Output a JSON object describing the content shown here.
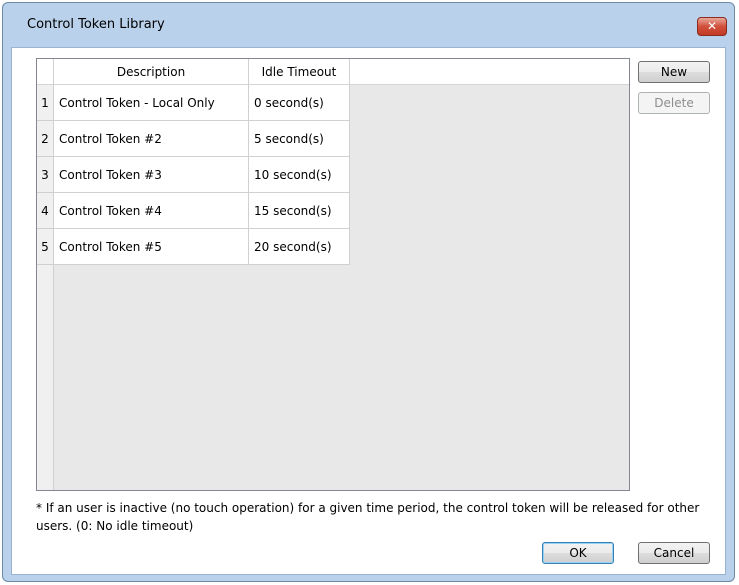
{
  "window": {
    "title": "Control Token Library",
    "close_icon": "close-icon"
  },
  "table": {
    "columns": [
      "Description",
      "Idle Timeout"
    ],
    "rows": [
      {
        "num": "1",
        "description": "Control Token - Local Only",
        "timeout": "0 second(s)"
      },
      {
        "num": "2",
        "description": "Control Token #2",
        "timeout": "5 second(s)"
      },
      {
        "num": "3",
        "description": "Control Token #3",
        "timeout": "10 second(s)"
      },
      {
        "num": "4",
        "description": "Control Token #4",
        "timeout": "15 second(s)"
      },
      {
        "num": "5",
        "description": "Control Token #5",
        "timeout": "20 second(s)"
      }
    ]
  },
  "buttons": {
    "new": "New",
    "delete": "Delete",
    "ok": "OK",
    "cancel": "Cancel"
  },
  "footnote": "* If an user is inactive (no touch operation) for a given time period, the control token will be released for other users. (0: No idle timeout)"
}
